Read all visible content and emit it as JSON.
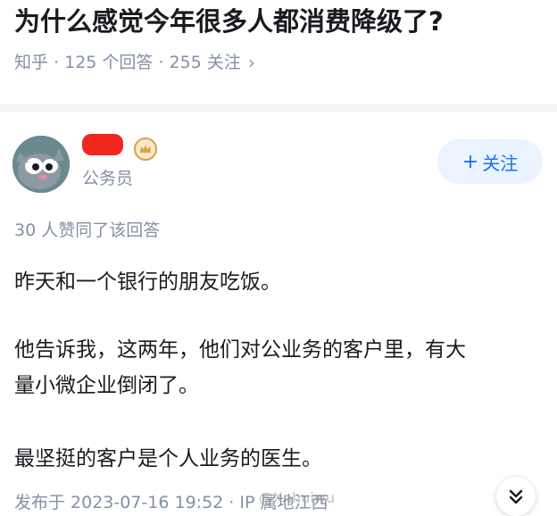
{
  "question": {
    "title": "为什么感觉今年很多人都消费降级了?",
    "meta": "知乎 · 125 个回答 · 255 关注",
    "chevron_icon": "chevron-right-icon"
  },
  "author": {
    "role": "公务员",
    "avatar_icon": "cartoon-cat-avatar-icon",
    "badge_icon": "crown-badge-icon",
    "badge_color": "#d9a14a",
    "follow_label": "关注",
    "follow_color": "#1772f6"
  },
  "answer": {
    "upvotes": "30 人赞同了该回答",
    "paragraphs": [
      "昨天和一个银行的朋友吃饭。",
      "他告诉我，这两年，他们对公业务的客户里，有大",
      "量小微企业倒闭了。",
      "最坚挺的客户是个人业务的医生。"
    ],
    "footer": "发布于 2023-07-16 19:52 · IP 属地江西",
    "watermark": "@Xnhuiwu",
    "expand_icon": "double-chevron-down-icon"
  }
}
